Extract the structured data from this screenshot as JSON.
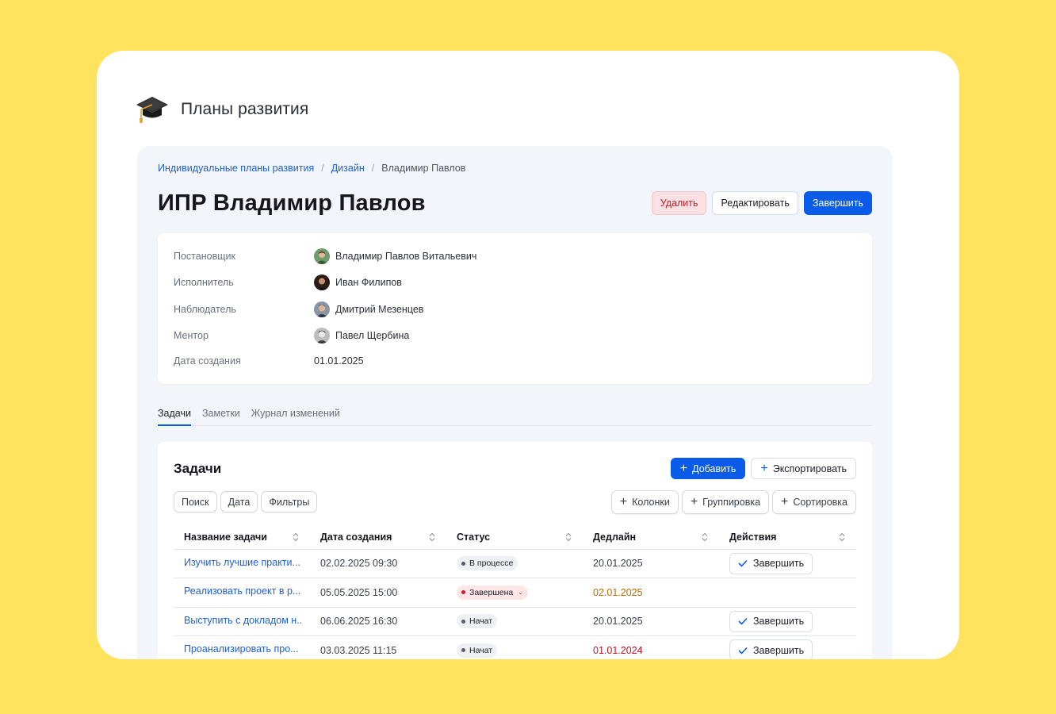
{
  "app": {
    "title": "Планы развития",
    "logo_icon": "graduation-cap-icon"
  },
  "breadcrumb": [
    "Индивидуальные планы развития",
    "Дизайн",
    "Владимир Павлов"
  ],
  "page": {
    "title": "ИПР Владимир Павлов",
    "buttons": {
      "delete": "Удалить",
      "edit": "Редактировать",
      "complete": "Завершить"
    }
  },
  "info": [
    {
      "label": "Постановщик",
      "value": "Владимир Павлов Витальевич",
      "avatar": "avatar-green"
    },
    {
      "label": "Исполнитель",
      "value": "Иван Филипов",
      "avatar": "avatar-dark"
    },
    {
      "label": "Наблюдатель",
      "value": "Дмитрий Мезенцев",
      "avatar": "avatar-gray"
    },
    {
      "label": "Ментор",
      "value": "Павел Щербина",
      "avatar": "avatar-bw"
    },
    {
      "label": "Дата создания",
      "value": "01.01.2025"
    }
  ],
  "tabs": [
    "Задачи",
    "Заметки",
    "Журнал изменений"
  ],
  "tasks": {
    "title": "Задачи",
    "add": "Добавить",
    "export": "Экспортировать",
    "filters": [
      "Поиск",
      "Дата",
      "Фильтры"
    ],
    "view_options": [
      "Колонки",
      "Группировка",
      "Сортировка"
    ],
    "columns": [
      "Название задачи",
      "Дата создания",
      "Статус",
      "Дедлайн",
      "Действия"
    ],
    "rows": [
      {
        "name": "Изучить лучшие практи...",
        "created": "02.02.2025 09:30",
        "status": "В процессе",
        "deadline": "20.01.2025",
        "action": "Завершить"
      },
      {
        "name": "Реализовать проект в р...",
        "created": "05.05.2025 15:00",
        "status": "Завершена",
        "deadline": "02.01.2025",
        "action": ""
      },
      {
        "name": "Выступить с докладом н...",
        "created": "06.06.2025 16:30",
        "status": "Начат",
        "deadline": "20.01.2025",
        "action": "Завершить"
      },
      {
        "name": "Проанализировать про...",
        "created": "03.03.2025 11:15",
        "status": "Начат",
        "deadline": "01.01.2024",
        "action": "Завершить"
      }
    ]
  },
  "colors": {
    "background": "#ffe35f",
    "primary": "#0a5ce8",
    "danger": "#c21d2b",
    "warning": "#c06800"
  }
}
